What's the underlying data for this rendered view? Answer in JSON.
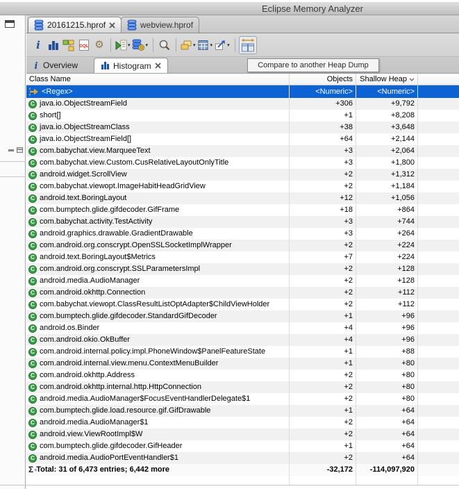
{
  "window": {
    "title": "Eclipse Memory Analyzer"
  },
  "editor_tabs": [
    {
      "label": "20161215.hprof",
      "active": true,
      "icon": "heap-dump-icon",
      "closable": true
    },
    {
      "label": "webview.hprof",
      "active": false,
      "icon": "heap-dump-icon",
      "closable": false
    }
  ],
  "toolbar": {
    "tooltip": "Compare to another Heap Dump",
    "icons": [
      "info-icon",
      "histogram-icon",
      "dominator-tree-icon",
      "oql-icon",
      "gear-icon",
      "query-menu-icon",
      "heap-dump-gear-icon",
      "search-icon",
      "group-by-icon",
      "calculator-icon",
      "export-icon",
      "compare-heap-dump-icon"
    ]
  },
  "view_tabs": [
    {
      "label": "Overview",
      "active": false,
      "icon": "info-icon"
    },
    {
      "label": "Histogram",
      "active": true,
      "icon": "histogram-icon",
      "closable": true
    }
  ],
  "table": {
    "columns": {
      "name": "Class Name",
      "objects": "Objects",
      "shallow": "Shallow Heap"
    },
    "filter": {
      "name": "<Regex>",
      "objects": "<Numeric>",
      "shallow": "<Numeric>"
    },
    "rows": [
      {
        "name": "java.io.ObjectStreamField",
        "objects": "+306",
        "shallow": "+9,792"
      },
      {
        "name": "short[]",
        "objects": "+1",
        "shallow": "+8,208"
      },
      {
        "name": "java.io.ObjectStreamClass",
        "objects": "+38",
        "shallow": "+3,648"
      },
      {
        "name": "java.io.ObjectStreamField[]",
        "objects": "+64",
        "shallow": "+2,144"
      },
      {
        "name": "com.babychat.view.MarqueeText",
        "objects": "+3",
        "shallow": "+2,064"
      },
      {
        "name": "com.babychat.view.Custom.CusRelativeLayoutOnlyTitle",
        "objects": "+3",
        "shallow": "+1,800"
      },
      {
        "name": "android.widget.ScrollView",
        "objects": "+2",
        "shallow": "+1,312"
      },
      {
        "name": "com.babychat.viewopt.ImageHabitHeadGridView",
        "objects": "+2",
        "shallow": "+1,184"
      },
      {
        "name": "android.text.BoringLayout",
        "objects": "+12",
        "shallow": "+1,056"
      },
      {
        "name": "com.bumptech.glide.gifdecoder.GifFrame",
        "objects": "+18",
        "shallow": "+864"
      },
      {
        "name": "com.babychat.activity.TestActivity",
        "objects": "+3",
        "shallow": "+744"
      },
      {
        "name": "android.graphics.drawable.GradientDrawable",
        "objects": "+3",
        "shallow": "+264"
      },
      {
        "name": "com.android.org.conscrypt.OpenSSLSocketImplWrapper",
        "objects": "+2",
        "shallow": "+224"
      },
      {
        "name": "android.text.BoringLayout$Metrics",
        "objects": "+7",
        "shallow": "+224"
      },
      {
        "name": "com.android.org.conscrypt.SSLParametersImpl",
        "objects": "+2",
        "shallow": "+128"
      },
      {
        "name": "android.media.AudioManager",
        "objects": "+2",
        "shallow": "+128"
      },
      {
        "name": "com.android.okhttp.Connection",
        "objects": "+2",
        "shallow": "+112"
      },
      {
        "name": "com.babychat.viewopt.ClassResultListOptAdapter$ChildViewHolder",
        "objects": "+2",
        "shallow": "+112"
      },
      {
        "name": "com.bumptech.glide.gifdecoder.StandardGifDecoder",
        "objects": "+1",
        "shallow": "+96"
      },
      {
        "name": "android.os.Binder",
        "objects": "+4",
        "shallow": "+96"
      },
      {
        "name": "com.android.okio.OkBuffer",
        "objects": "+4",
        "shallow": "+96"
      },
      {
        "name": "com.android.internal.policy.impl.PhoneWindow$PanelFeatureState",
        "objects": "+1",
        "shallow": "+88"
      },
      {
        "name": "com.android.internal.view.menu.ContextMenuBuilder",
        "objects": "+1",
        "shallow": "+80"
      },
      {
        "name": "com.android.okhttp.Address",
        "objects": "+2",
        "shallow": "+80"
      },
      {
        "name": "com.android.okhttp.internal.http.HttpConnection",
        "objects": "+2",
        "shallow": "+80"
      },
      {
        "name": "android.media.AudioManager$FocusEventHandlerDelegate$1",
        "objects": "+2",
        "shallow": "+80"
      },
      {
        "name": "com.bumptech.glide.load.resource.gif.GifDrawable",
        "objects": "+1",
        "shallow": "+64"
      },
      {
        "name": "android.media.AudioManager$1",
        "objects": "+2",
        "shallow": "+64"
      },
      {
        "name": "android.view.ViewRootImpl$W",
        "objects": "+2",
        "shallow": "+64"
      },
      {
        "name": "com.bumptech.glide.gifdecoder.GifHeader",
        "objects": "+1",
        "shallow": "+64"
      },
      {
        "name": "android.media.AudioPortEventHandler$1",
        "objects": "+2",
        "shallow": "+64"
      }
    ],
    "total": {
      "label": "Total: 31 of 6,473 entries; 6,442 more",
      "objects": "-32,172",
      "shallow": "-114,097,920"
    }
  },
  "colors": {
    "selection_blue": "#0d63d3",
    "row_alt_gray": "#f1f1f1",
    "class_icon_green": "#3c9e47",
    "accent_blue": "#24509e",
    "gold": "#d9a326"
  }
}
